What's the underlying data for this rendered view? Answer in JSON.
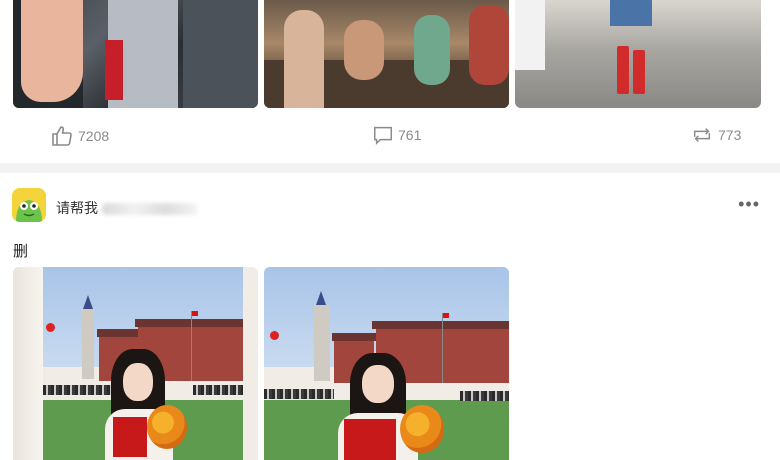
{
  "previous_post": {
    "actions": {
      "like_count": "7208",
      "comment_count": "761",
      "repost_count": "773"
    }
  },
  "post": {
    "username": "请帮我",
    "text": "删",
    "more_label": "•••"
  },
  "colors": {
    "icon_gray": "#8a8a8a",
    "divider": "#f2f2f2"
  }
}
